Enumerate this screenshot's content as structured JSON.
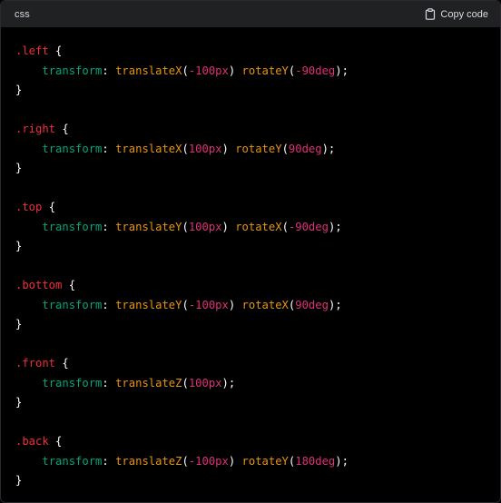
{
  "header": {
    "language": "css",
    "copy_label": "Copy code"
  },
  "colors": {
    "selector": "#f22c3d",
    "property": "#00a67d",
    "function": "#e9950c",
    "number": "#df3079",
    "punctuation": "#ffffff",
    "background": "#000000",
    "header_background": "#202123"
  },
  "code": {
    "lines": [
      [
        {
          "t": "sel",
          "v": ".left"
        },
        {
          "t": "punc",
          "v": " {"
        }
      ],
      [
        {
          "t": "plain",
          "v": "    "
        },
        {
          "t": "prop",
          "v": "transform"
        },
        {
          "t": "punc",
          "v": ": "
        },
        {
          "t": "fn",
          "v": "translateX"
        },
        {
          "t": "punc",
          "v": "("
        },
        {
          "t": "num",
          "v": "-100px"
        },
        {
          "t": "punc",
          "v": ") "
        },
        {
          "t": "fn",
          "v": "rotateY"
        },
        {
          "t": "punc",
          "v": "("
        },
        {
          "t": "num",
          "v": "-90deg"
        },
        {
          "t": "punc",
          "v": ");"
        }
      ],
      [
        {
          "t": "punc",
          "v": "}"
        }
      ],
      [],
      [
        {
          "t": "sel",
          "v": ".right"
        },
        {
          "t": "punc",
          "v": " {"
        }
      ],
      [
        {
          "t": "plain",
          "v": "    "
        },
        {
          "t": "prop",
          "v": "transform"
        },
        {
          "t": "punc",
          "v": ": "
        },
        {
          "t": "fn",
          "v": "translateX"
        },
        {
          "t": "punc",
          "v": "("
        },
        {
          "t": "num",
          "v": "100px"
        },
        {
          "t": "punc",
          "v": ") "
        },
        {
          "t": "fn",
          "v": "rotateY"
        },
        {
          "t": "punc",
          "v": "("
        },
        {
          "t": "num",
          "v": "90deg"
        },
        {
          "t": "punc",
          "v": ");"
        }
      ],
      [
        {
          "t": "punc",
          "v": "}"
        }
      ],
      [],
      [
        {
          "t": "sel",
          "v": ".top"
        },
        {
          "t": "punc",
          "v": " {"
        }
      ],
      [
        {
          "t": "plain",
          "v": "    "
        },
        {
          "t": "prop",
          "v": "transform"
        },
        {
          "t": "punc",
          "v": ": "
        },
        {
          "t": "fn",
          "v": "translateY"
        },
        {
          "t": "punc",
          "v": "("
        },
        {
          "t": "num",
          "v": "100px"
        },
        {
          "t": "punc",
          "v": ") "
        },
        {
          "t": "fn",
          "v": "rotateX"
        },
        {
          "t": "punc",
          "v": "("
        },
        {
          "t": "num",
          "v": "-90deg"
        },
        {
          "t": "punc",
          "v": ");"
        }
      ],
      [
        {
          "t": "punc",
          "v": "}"
        }
      ],
      [],
      [
        {
          "t": "sel",
          "v": ".bottom"
        },
        {
          "t": "punc",
          "v": " {"
        }
      ],
      [
        {
          "t": "plain",
          "v": "    "
        },
        {
          "t": "prop",
          "v": "transform"
        },
        {
          "t": "punc",
          "v": ": "
        },
        {
          "t": "fn",
          "v": "translateY"
        },
        {
          "t": "punc",
          "v": "("
        },
        {
          "t": "num",
          "v": "-100px"
        },
        {
          "t": "punc",
          "v": ") "
        },
        {
          "t": "fn",
          "v": "rotateX"
        },
        {
          "t": "punc",
          "v": "("
        },
        {
          "t": "num",
          "v": "90deg"
        },
        {
          "t": "punc",
          "v": ");"
        }
      ],
      [
        {
          "t": "punc",
          "v": "}"
        }
      ],
      [],
      [
        {
          "t": "sel",
          "v": ".front"
        },
        {
          "t": "punc",
          "v": " {"
        }
      ],
      [
        {
          "t": "plain",
          "v": "    "
        },
        {
          "t": "prop",
          "v": "transform"
        },
        {
          "t": "punc",
          "v": ": "
        },
        {
          "t": "fn",
          "v": "translateZ"
        },
        {
          "t": "punc",
          "v": "("
        },
        {
          "t": "num",
          "v": "100px"
        },
        {
          "t": "punc",
          "v": ");"
        }
      ],
      [
        {
          "t": "punc",
          "v": "}"
        }
      ],
      [],
      [
        {
          "t": "sel",
          "v": ".back"
        },
        {
          "t": "punc",
          "v": " {"
        }
      ],
      [
        {
          "t": "plain",
          "v": "    "
        },
        {
          "t": "prop",
          "v": "transform"
        },
        {
          "t": "punc",
          "v": ": "
        },
        {
          "t": "fn",
          "v": "translateZ"
        },
        {
          "t": "punc",
          "v": "("
        },
        {
          "t": "num",
          "v": "-100px"
        },
        {
          "t": "punc",
          "v": ") "
        },
        {
          "t": "fn",
          "v": "rotateY"
        },
        {
          "t": "punc",
          "v": "("
        },
        {
          "t": "num",
          "v": "180deg"
        },
        {
          "t": "punc",
          "v": ");"
        }
      ],
      [
        {
          "t": "punc",
          "v": "}"
        }
      ]
    ]
  }
}
